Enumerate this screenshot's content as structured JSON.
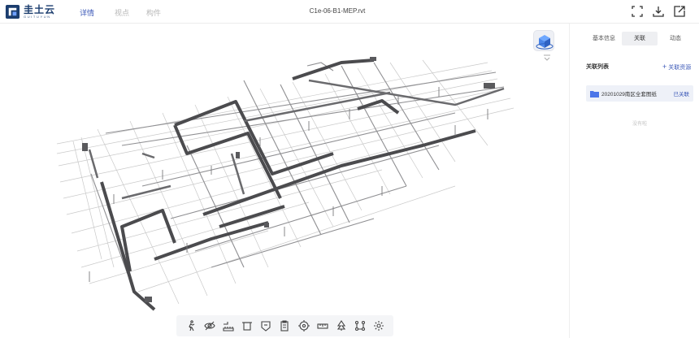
{
  "brand": {
    "name": "圭土云",
    "subtitle": "GUITUYUN"
  },
  "nav": {
    "tabs": [
      "详情",
      "视点",
      "构件"
    ],
    "active": 0
  },
  "document": {
    "title": "C1e-06-B1-MEP.rvt"
  },
  "panel": {
    "tabs": [
      "基本信息",
      "关联",
      "动态"
    ],
    "active_tab": 1,
    "list_title": "关联列表",
    "link_action": "关联资源",
    "items": [
      {
        "name": "20201029南区全套图纸",
        "status": "已关联"
      }
    ],
    "empty_text": "没有啦"
  },
  "toolbar": {
    "tools": [
      "walk-icon",
      "hide-icon",
      "measure-icon",
      "section-icon",
      "markup-icon",
      "clipboard-icon",
      "target-icon",
      "ruler-icon",
      "tree-icon",
      "nodes-icon",
      "settings-icon"
    ]
  },
  "colors": {
    "accent": "#3d5ab8",
    "pipe_dark": "#4b4b4e",
    "pipe_light": "#bcbcbc"
  }
}
